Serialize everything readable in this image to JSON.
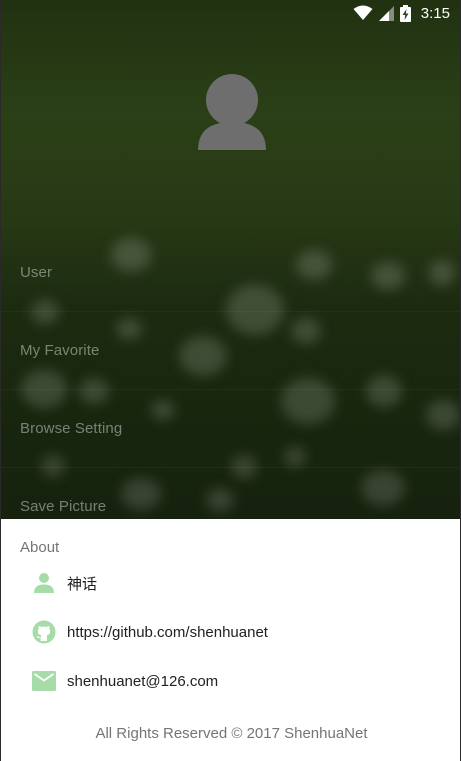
{
  "status_bar": {
    "time": "3:15",
    "icons": [
      "wifi-icon",
      "signal-icon",
      "battery-charging-icon"
    ]
  },
  "drawer": {
    "avatar_icon": "person-avatar-icon",
    "menu_items": [
      {
        "label": "User"
      },
      {
        "label": "My Favorite"
      },
      {
        "label": "Browse Setting"
      },
      {
        "label": "Save Picture"
      }
    ]
  },
  "about": {
    "title": "About",
    "author_name": "神话",
    "github_url": "https://github.com/shenhuanet",
    "email": "shenhuanet@126.com",
    "footer": "All Rights Reserved © 2017 ShenhuaNet"
  },
  "colors": {
    "icon_green": "#A5DCA8",
    "avatar_gray": "#6E6E6E",
    "menu_text": "#C8CDC3",
    "secondary_text": "#757575",
    "primary_text": "#212121"
  }
}
